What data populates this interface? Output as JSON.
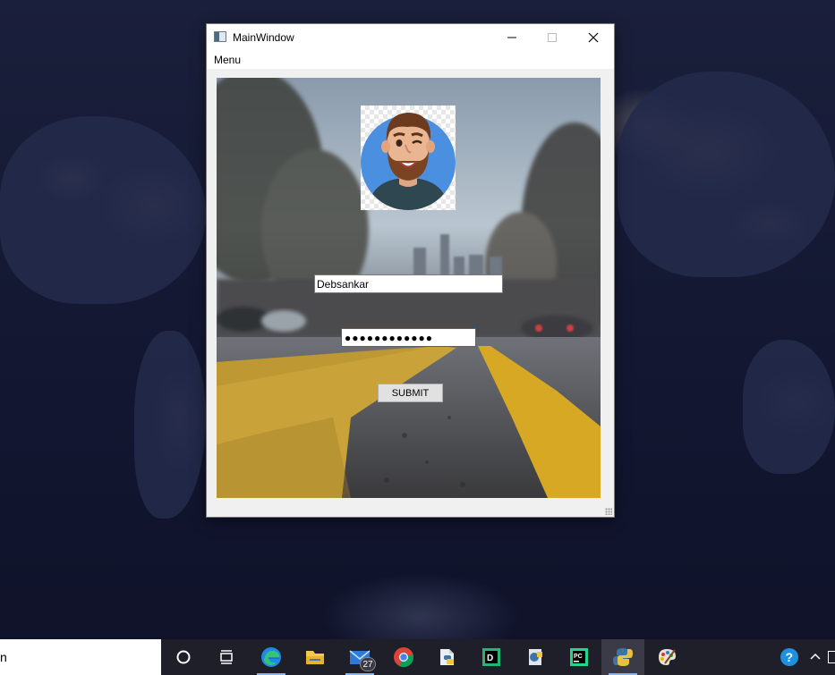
{
  "window": {
    "title": "MainWindow",
    "menu": [
      "Menu"
    ]
  },
  "login": {
    "username_value": "Debsankar",
    "password_value": "●●●●●●●●●●●●",
    "submit_label": "SUBMIT"
  },
  "taskbar": {
    "search_text": "n",
    "apps": [
      {
        "icon": "cortana-icon"
      },
      {
        "icon": "task-view-icon"
      },
      {
        "icon": "edge-icon"
      },
      {
        "icon": "file-explorer-icon"
      },
      {
        "icon": "mail-icon",
        "badge": "27"
      },
      {
        "icon": "chrome-icon"
      },
      {
        "icon": "python-launcher-icon"
      },
      {
        "icon": "datagrip-icon",
        "letter": "D"
      },
      {
        "icon": "app-icon"
      },
      {
        "icon": "pycharm-icon",
        "letter": "PC"
      },
      {
        "icon": "python-icon"
      },
      {
        "icon": "paint-icon"
      }
    ],
    "tray": [
      {
        "icon": "help-icon",
        "text": "?"
      },
      {
        "icon": "chevron-up-icon"
      }
    ]
  }
}
